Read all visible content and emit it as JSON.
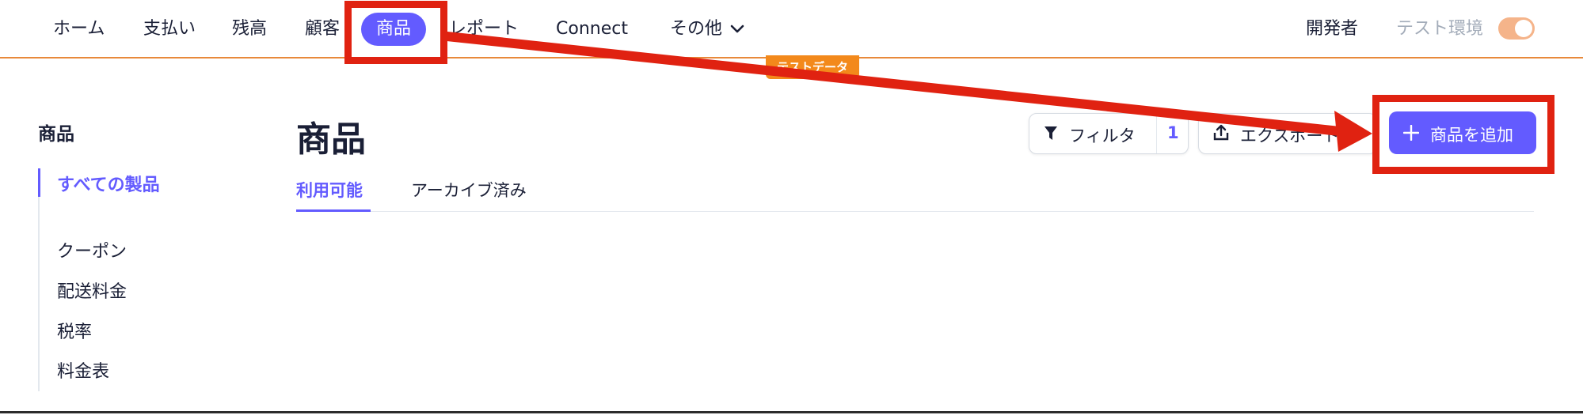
{
  "nav": {
    "items": [
      {
        "label": "ホーム"
      },
      {
        "label": "支払い"
      },
      {
        "label": "残高"
      },
      {
        "label": "顧客"
      },
      {
        "label": "商品"
      },
      {
        "label": "レポート"
      },
      {
        "label": "Connect"
      },
      {
        "label": "その他"
      }
    ],
    "developer": "開発者",
    "test_mode_label": "テスト環境",
    "test_mode_on": true,
    "test_badge": "テストデータ"
  },
  "sidebar": {
    "title": "商品",
    "items": [
      {
        "label": "すべての製品"
      },
      {
        "label": "クーポン"
      },
      {
        "label": "配送料金"
      },
      {
        "label": "税率"
      },
      {
        "label": "料金表"
      }
    ]
  },
  "main": {
    "title": "商品",
    "filter_label": "フィルタ",
    "filter_count": "1",
    "export_label": "エクスポート",
    "add_label": "商品を追加",
    "tabs": [
      {
        "label": "利用可能"
      },
      {
        "label": "アーカイブ済み"
      }
    ]
  },
  "colors": {
    "accent": "#635bff",
    "test_orange": "#f3891b",
    "annotation_red": "#e02211"
  }
}
